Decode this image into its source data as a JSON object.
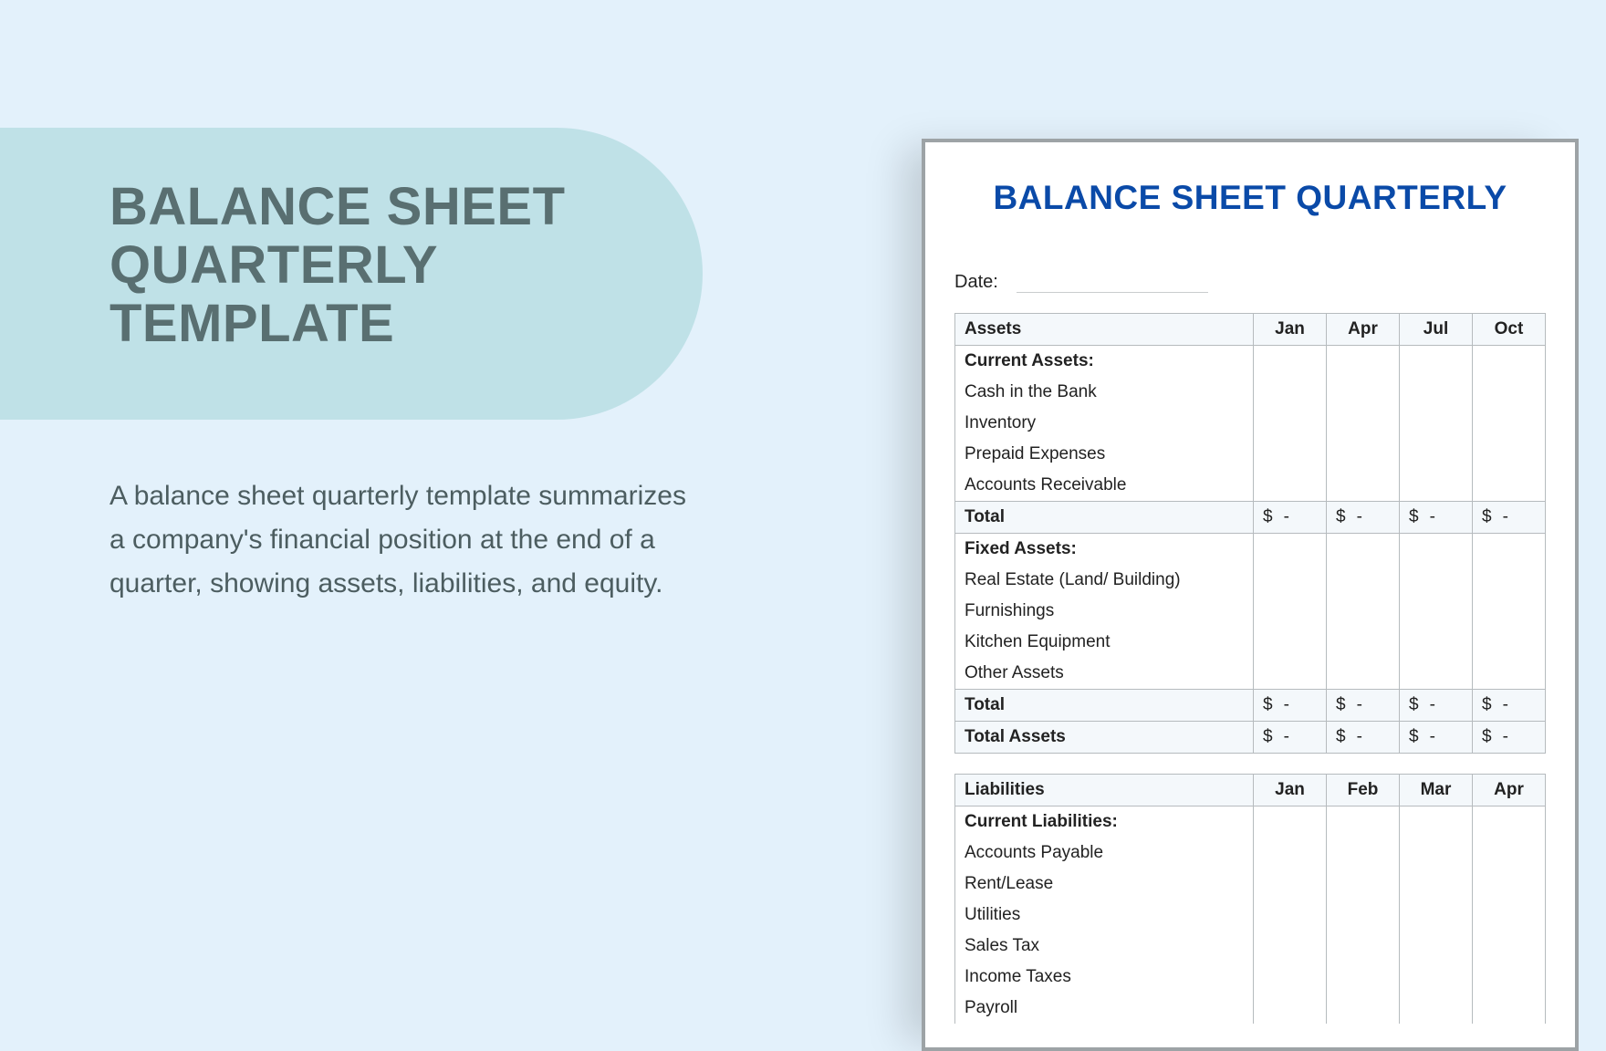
{
  "promo": {
    "title": "BALANCE SHEET QUARTERLY TEMPLATE",
    "description": "A balance sheet quarterly template summarizes a company's financial position at the end of a quarter, showing assets, liabilities, and equity."
  },
  "document": {
    "title": "BALANCE SHEET QUARTERLY",
    "date_label": "Date:",
    "amt_placeholder": "$",
    "dash": "-",
    "tables": {
      "assets": {
        "header_label": "Assets",
        "months": [
          "Jan",
          "Apr",
          "Jul",
          "Oct"
        ],
        "sections": [
          {
            "heading": "Current Assets:",
            "items": [
              "Cash in the Bank",
              "Inventory",
              "Prepaid Expenses",
              "Accounts Receivable"
            ],
            "total_label": "Total"
          },
          {
            "heading": "Fixed Assets:",
            "items": [
              "Real Estate (Land/ Building)",
              "Furnishings",
              "Kitchen Equipment",
              "Other Assets"
            ],
            "total_label": "Total"
          }
        ],
        "grand_total_label": "Total Assets"
      },
      "liabilities": {
        "header_label": "Liabilities",
        "months": [
          "Jan",
          "Feb",
          "Mar",
          "Apr"
        ],
        "sections": [
          {
            "heading": "Current Liabilities:",
            "items": [
              "Accounts Payable",
              "Rent/Lease",
              "Utilities",
              "Sales Tax",
              "Income Taxes",
              "Payroll"
            ]
          }
        ]
      }
    }
  }
}
